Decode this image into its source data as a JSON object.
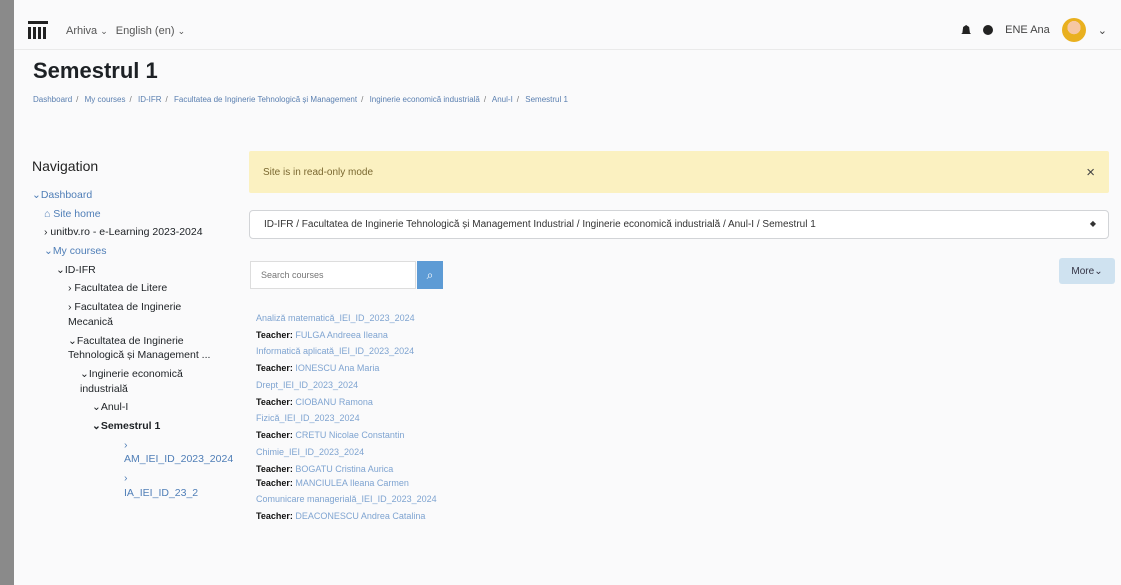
{
  "header": {
    "menu": [
      "Arhiva",
      "English (en)"
    ],
    "user": "ENE Ana"
  },
  "page": {
    "title": "Semestrul 1",
    "breadcrumb": [
      "Dashboard",
      "My courses",
      "ID-IFR",
      "Facultatea de Inginerie Tehnologică și Management",
      "Inginerie economică industrială",
      "Anul-I",
      "Semestrul 1"
    ]
  },
  "navigation": {
    "title": "Navigation",
    "items": [
      {
        "label": "Dashboard",
        "expanded": true
      },
      {
        "label": "Site home"
      },
      {
        "label": "unitbv.ro - e-Learning 2023-2024"
      },
      {
        "label": "My courses",
        "expanded": true
      },
      {
        "label": "ID-IFR",
        "expanded": true
      },
      {
        "label": "Facultatea de Litere"
      },
      {
        "label": "Facultatea de Inginerie Mecanică"
      },
      {
        "label": "Facultatea de Inginerie Tehnologică și Management ...",
        "expanded": true
      },
      {
        "label": "Inginerie economică industrială",
        "expanded": true
      },
      {
        "label": "Anul-I",
        "expanded": true
      },
      {
        "label": "Semestrul 1",
        "expanded": true
      },
      {
        "label": "AM_IEI_ID_2023_2024"
      },
      {
        "label": "IA_IEI_ID_23_2"
      }
    ]
  },
  "alert": {
    "text": "Site is in read-only mode",
    "close": "×"
  },
  "category_select": {
    "value": "ID-IFR / Facultatea de Inginerie Tehnologică și Management Industrial / Inginerie economică industrială / Anul-I / Semestrul 1"
  },
  "search": {
    "placeholder": "Search courses"
  },
  "more_button": {
    "label": "More"
  },
  "courses": [
    {
      "name": "Analiză matematică_IEI_ID_2023_2024",
      "teachers": [
        "FULGA Andreea Ileana"
      ]
    },
    {
      "name": "Informatică aplicată_IEI_ID_2023_2024",
      "teachers": [
        "IONESCU Ana Maria"
      ]
    },
    {
      "name": "Drept_IEI_ID_2023_2024",
      "teachers": [
        "CIOBANU Ramona"
      ]
    },
    {
      "name": "Fizică_IEI_ID_2023_2024",
      "teachers": [
        "CRETU Nicolae Constantin"
      ]
    },
    {
      "name": "Chimie_IEI_ID_2023_2024",
      "teachers": [
        "BOGATU Cristina Aurica",
        "MANCIULEA Ileana Carmen"
      ]
    },
    {
      "name": "Comunicare managerială_IEI_ID_2023_2024",
      "teachers": [
        "DEACONESCU Andrea Catalina"
      ]
    }
  ],
  "labels": {
    "teacher": "Teacher:"
  },
  "colors": {
    "link": "#4f7eb7",
    "alert": "#fbf1c1",
    "button": "#5d9bd5"
  },
  "icons": {
    "logo": "university-logo-icon",
    "search": "search-icon",
    "notification": "bell-icon",
    "messages": "chat-icon",
    "dropdown": "chevron-down-icon"
  }
}
